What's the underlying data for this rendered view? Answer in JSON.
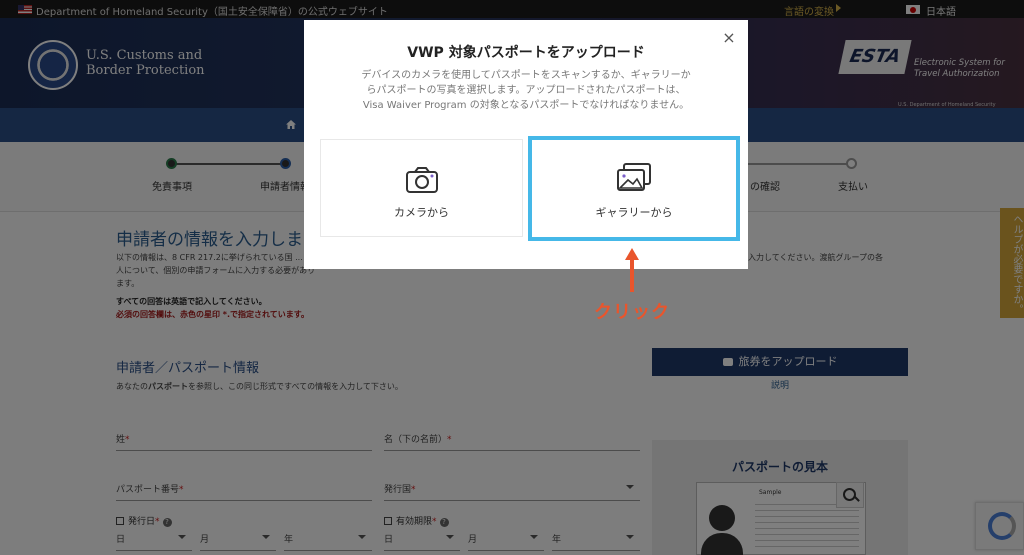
{
  "govbar": {
    "text": "Department of Homeland Security（国土安全保障省）の公式ウェブサイト",
    "lang_toggle": "言語の変換",
    "lang_current": "日本語"
  },
  "header": {
    "agency_line1": "U.S. Customs and",
    "agency_line2": "Border Protection",
    "esta_logo": "ESTA",
    "esta_line1": "Electronic System for",
    "esta_line2": "Travel Authorization",
    "esta_sub": "U.S. Department of Homeland Security"
  },
  "progress": {
    "steps": [
      "免責事項",
      "申請者情報",
      "の確認",
      "支払い"
    ]
  },
  "content": {
    "page_title": "申請者の情報を入力しま",
    "intro": "以下の情報は、8 CFR 217.2に挙げられている国 ... 個人について、個別の申請フォームに入力する必要があります。",
    "intro_right": "入力してください。渡航グループの各",
    "note_black": "すべての回答は英語で記入してください。",
    "note_red": "必須の回答欄は、赤色の星印 *.で指定されています。",
    "section_title": "申請者／パスポート情報",
    "section_desc_pre": "あなたの",
    "section_desc_bold": "パスポート",
    "section_desc_post": "を参照し、この同じ形式ですべての情報を入力して下さい。",
    "upload_button": "旅券をアップロード",
    "explain_link": "説明",
    "fields": {
      "surname": "姓",
      "given_name": "名（下の名前）",
      "passport_number": "パスポート番号",
      "issuing_country": "発行国",
      "issue_date": "発行日",
      "expiry_date": "有効期限",
      "day": "日",
      "month": "月",
      "year": "年",
      "required_mark": "*"
    },
    "sample_title": "パスポートの見本",
    "sample_word": "Sample",
    "help_tab": "ヘルプが必要ですか。"
  },
  "modal": {
    "title": "VWP 対象パスポートをアップロード",
    "close": "×",
    "description": "デバイスのカメラを使用してパスポートをスキャンするか、ギャラリーからパスポートの写真を選択します。アップロードされたパスポートは、Visa Waiver Program の対象となるパスポートでなければなりません。",
    "camera_option": "カメラから",
    "gallery_option": "ギャラリーから"
  },
  "annotation": {
    "label": "クリック",
    "color": "#e9552c"
  },
  "colors": {
    "highlight_border": "#45b8e8",
    "primary_button": "#1f3869",
    "required_red": "#a51a1a"
  }
}
